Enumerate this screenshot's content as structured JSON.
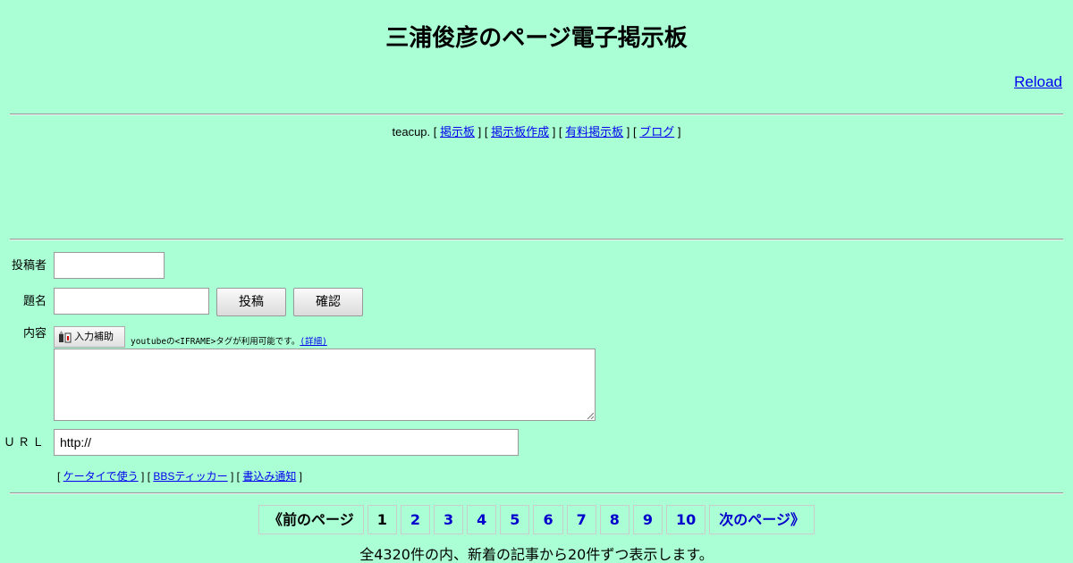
{
  "header": {
    "title": "三浦俊彦のページ電子掲示板",
    "reload_label": "Reload"
  },
  "teacup": {
    "brand": "teacup.",
    "links": [
      "掲示板",
      "掲示板作成",
      "有料掲示板",
      "ブログ"
    ]
  },
  "form": {
    "author_label": "投稿者",
    "author_value": "",
    "subject_label": "題名",
    "subject_value": "",
    "post_button": "投稿",
    "confirm_button": "確認",
    "content_label": "内容",
    "assist_button": "入力補助",
    "hint_text": "youtubeの<IFRAME>タグが利用可能です。",
    "hint_link": "(詳細)",
    "content_value": "",
    "url_label": "ＵＲＬ",
    "url_value": "http://"
  },
  "footer_links": [
    "ケータイで使う",
    "BBSティッカー",
    "書込み通知"
  ],
  "pager": {
    "prev_label": "《前のページ",
    "pages": [
      "1",
      "2",
      "3",
      "4",
      "5",
      "6",
      "7",
      "8",
      "9",
      "10"
    ],
    "current_page": "1",
    "next_label": "次のページ》"
  },
  "summary": "全4320件の内、新着の記事から20件ずつ表示します。",
  "colors": {
    "background": "#aaffd4",
    "link": "#0000ee"
  }
}
